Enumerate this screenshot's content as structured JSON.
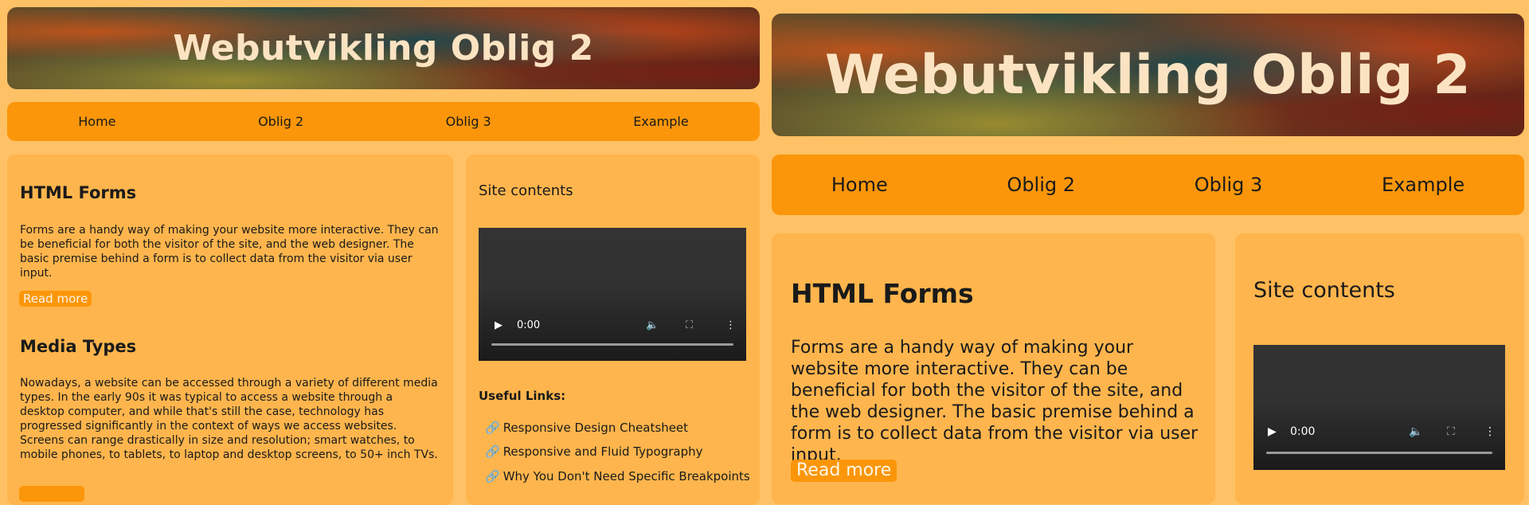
{
  "site": {
    "title": "Webutvikling Oblig 2",
    "nav": [
      "Home",
      "Oblig 2",
      "Oblig 3",
      "Example"
    ]
  },
  "main": {
    "sections": [
      {
        "heading": "HTML Forms",
        "text": "Forms are a handy way of making your website more interactive. They can be beneficial for both the visitor of the site, and the web designer. The basic premise behind a form is to collect data from the visitor via user input.",
        "button": "Read more"
      },
      {
        "heading": "Media Types",
        "text": "Nowadays, a website can be accessed through a variety of different media types. In the early 90s it was typical to access a website through a desktop computer, and while that's still the case, technology has progressed significantly in the context of ways we access websites. Screens can range drastically in size and resolution; smart watches, to mobile phones, to tablets, to laptop and desktop screens, to 50+ inch TVs."
      }
    ]
  },
  "aside": {
    "heading": "Site contents",
    "video_time": "0:00",
    "links_heading": "Useful Links:",
    "links": [
      "Responsive Design Cheatsheet",
      "Responsive and Fluid Typography",
      "Why You Don't Need Specific Breakpoints"
    ]
  },
  "colors": {
    "background": "#ffc165",
    "nav": "#fb960a",
    "card": "#ffb54d",
    "title": "#fbe3c2"
  }
}
